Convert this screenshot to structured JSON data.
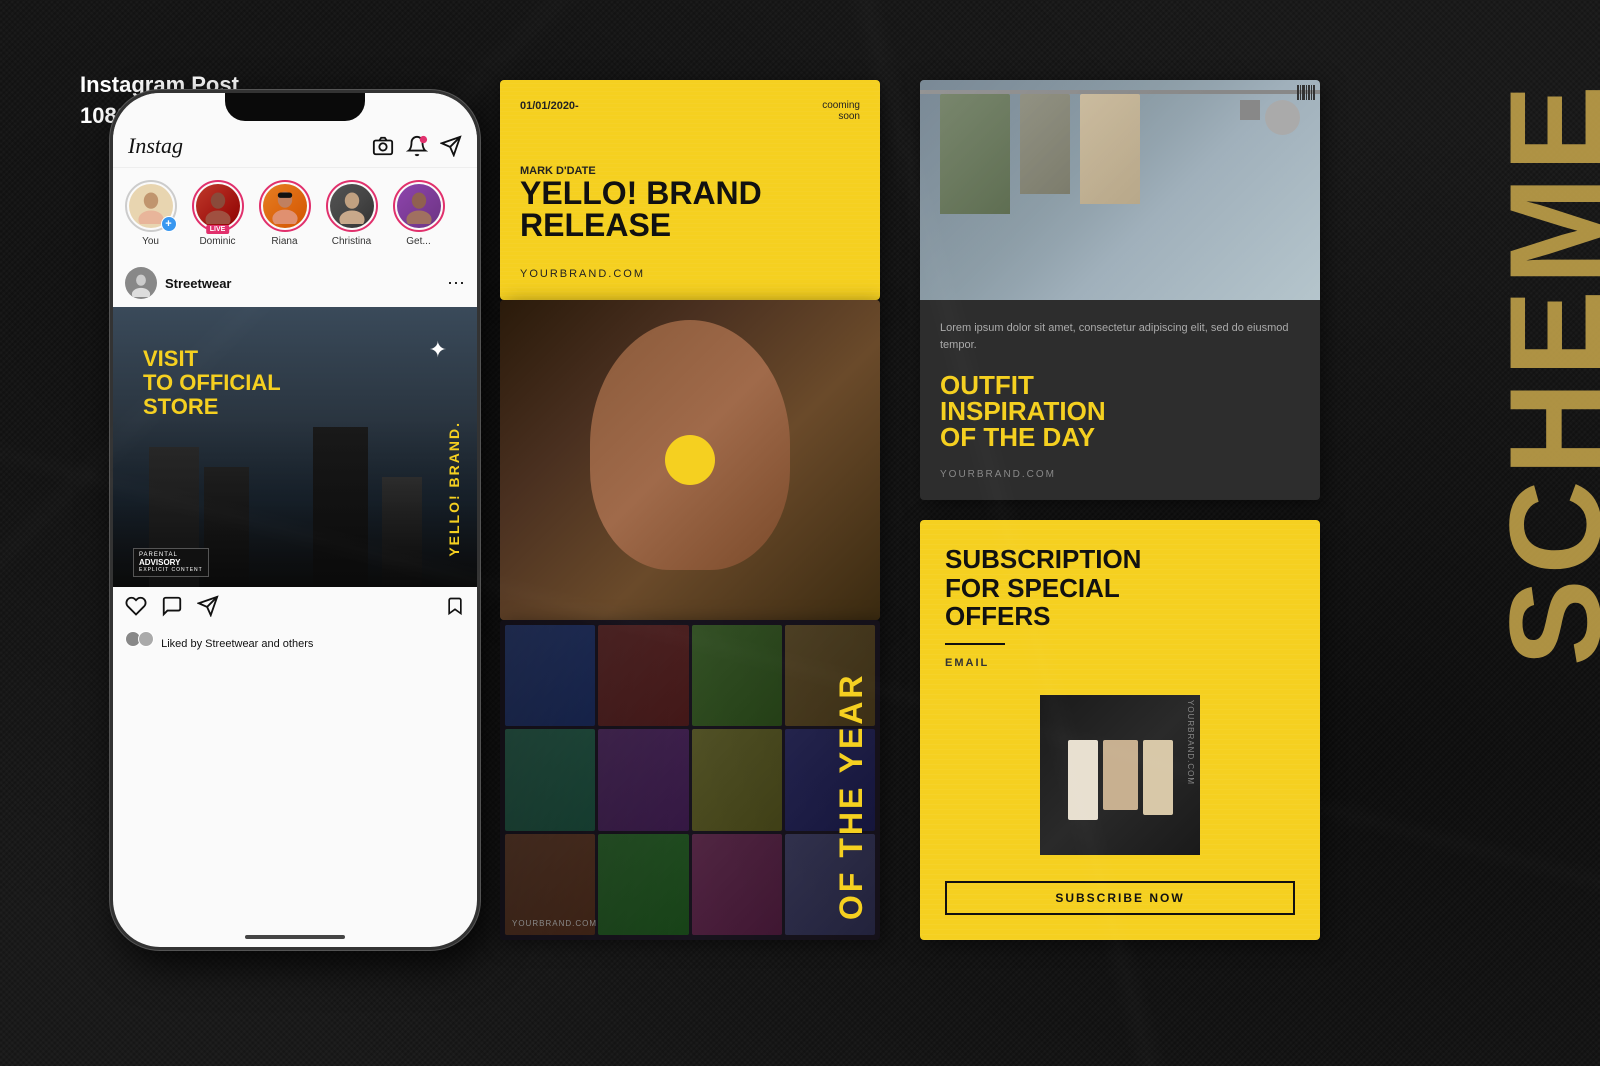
{
  "page": {
    "background_color": "#1a1a1a"
  },
  "top_label": {
    "line1": "Instagram Post",
    "line2": "1080x1080px"
  },
  "side_text": "SCHEME",
  "phone": {
    "app_name": "Instag",
    "stories": [
      {
        "id": "you",
        "label": "You",
        "has_plus": true,
        "has_live": false
      },
      {
        "id": "dominic",
        "label": "Dominic",
        "has_plus": false,
        "has_live": true
      },
      {
        "id": "riana",
        "label": "Riana",
        "has_plus": false,
        "has_live": false
      },
      {
        "id": "christina",
        "label": "Christina",
        "has_plus": false,
        "has_live": false
      },
      {
        "id": "get",
        "label": "Get...",
        "has_plus": false,
        "has_live": false
      }
    ],
    "post": {
      "username": "Streetwear",
      "visit_text": "VISIT\nTO OFFICIAL\nSTORE",
      "brand_vertical": "YELLO! BRAND.",
      "likes_text": "Liked by Streetwear and others"
    }
  },
  "cards": {
    "card1": {
      "date": "01/01/2020-",
      "coming_soon": "cooming\nsoon",
      "brand_name": "MARK D'DATE",
      "title_line1": "YELLO! BRAND",
      "title_line2": "RELEASE",
      "url": "YOURBRAND.COM"
    },
    "card2": {
      "circle_symbol": "●"
    },
    "card3": {
      "title": "OF THE\nYEAR",
      "url": "YOURBRAND.COM"
    },
    "card4": {
      "lorem": "Lorem ipsum dolor sit amet,\nconsectetur adipiscing elit,\nsed do eiusmod tempor.",
      "title_line1": "OUTFIT",
      "title_line2": "INSPIRATION",
      "title_line3": "OF THE DAY",
      "url": "YOURBRAND.COM"
    },
    "card5": {
      "title_line1": "SUBSCRIPTION",
      "title_line2": "FOR SPECIAL",
      "title_line3": "OFFERS",
      "email_label": "EMAIL",
      "url": "YOURBRAND.COM",
      "button_label": "SUBSCRIBE NOW"
    }
  }
}
